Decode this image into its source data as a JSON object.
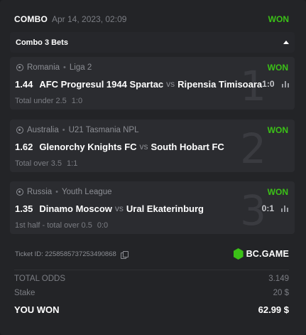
{
  "header": {
    "combo_label": "COMBO",
    "date": "Apr 14, 2023, 02:09",
    "status": "WON"
  },
  "combo_bar": {
    "label": "Combo 3 Bets",
    "icon": "caret-up-icon"
  },
  "bets": [
    {
      "number": "1",
      "country": "Romania",
      "league": "Liga 2",
      "status": "WON",
      "odd": "1.44",
      "home": "AFC Progresul 1944 Spartac",
      "vs": "vs",
      "away": "Ripensia Timisoara",
      "score": "1:0",
      "market": "Total under 2.5",
      "result": "1:0"
    },
    {
      "number": "2",
      "country": "Australia",
      "league": "U21 Tasmania NPL",
      "status": "WON",
      "odd": "1.62",
      "home": "Glenorchy Knights FC",
      "vs": "vs",
      "away": "South Hobart FC",
      "score": "",
      "market": "Total over 3.5",
      "result": "1:1"
    },
    {
      "number": "3",
      "country": "Russia",
      "league": "Youth League",
      "status": "WON",
      "odd": "1.35",
      "home": "Dinamo Moscow",
      "vs": "vs",
      "away": "Ural Ekaterinburg",
      "score": "0:1",
      "market": "1st half - total over 0.5",
      "result": "0:0"
    }
  ],
  "footer": {
    "ticket_id": "Ticket ID: 2258585737253490868",
    "brand": "BC.GAME"
  },
  "summary": {
    "total_odds_label": "TOTAL ODDS",
    "total_odds_value": "3.149",
    "stake_label": "Stake",
    "stake_value": "20 $",
    "won_label": "YOU WON",
    "won_value": "62.99 $"
  },
  "colors": {
    "accent_green": "#3bc117",
    "background": "#232427",
    "card": "#2b2c30"
  }
}
